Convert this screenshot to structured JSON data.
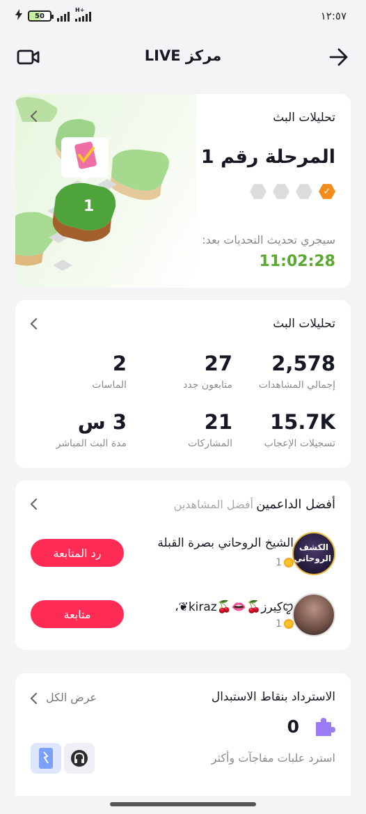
{
  "status_bar": {
    "time": "١٢:٥٧",
    "battery": "50",
    "network": "H+"
  },
  "header": {
    "title": "مركز LIVE",
    "video_icon": "video-camera-icon",
    "back_icon": "arrow-right-icon"
  },
  "stage_card": {
    "title": "تحليلات البث",
    "stage": "المرحلة رقم 1",
    "progress_levels_completed": 1,
    "progress_levels_total": 4,
    "refresh_label": "سيجري تحديث التحديات بعد:",
    "countdown": "11:02:28",
    "badge_number": "1"
  },
  "analytics": {
    "title": "تحليلات البث",
    "stats": [
      {
        "value": "2,578",
        "label": "إجمالي المشاهدات"
      },
      {
        "value": "27",
        "label": "متابعون جدد"
      },
      {
        "value": "2",
        "label": "الماسات"
      },
      {
        "value": "15.7K",
        "label": "تسجيلات الإعجاب"
      },
      {
        "value": "21",
        "label": "المشاركات"
      },
      {
        "value": "3 س",
        "label": "مدة البث المباشر"
      }
    ]
  },
  "supporters": {
    "tab_active": "أفضل الداعمين",
    "tab_inactive": "أفضل المشاهدين",
    "rows": [
      {
        "name": "الشيخ الروحاني بصرة القبلة",
        "coins": "1",
        "button": "رد المتابعة",
        "avatar_text": "الكشف الروحاني"
      },
      {
        "name": "ꨄ︎كِيرز🍒👄🍒kiraz❦︎،",
        "coins": "1",
        "button": "متابعة"
      }
    ]
  },
  "rewards": {
    "title": "الاسترداد بنقاط الاستبدال",
    "view_all": "عرض الكل",
    "points": "0",
    "subtitle": "استرد علبات مفاجآت وأكثر"
  },
  "colors": {
    "accent": "#fe2c55",
    "timer_green": "#5aa830",
    "badge_orange": "#f28c1b"
  }
}
